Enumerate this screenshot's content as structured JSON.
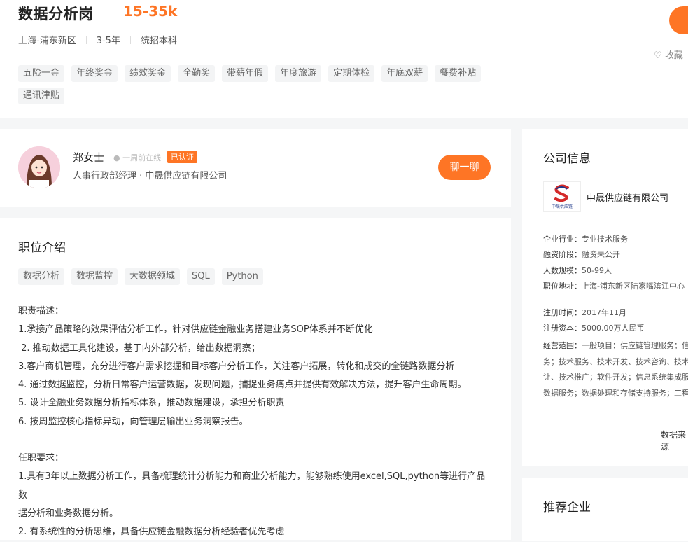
{
  "job": {
    "title": "数据分析岗",
    "salary": "15-35k",
    "location": "上海-浦东新区",
    "experience": "3-5年",
    "education": "统招本科",
    "collect_label": "收藏",
    "benefits": [
      "五险一金",
      "年终奖金",
      "绩效奖金",
      "全勤奖",
      "带薪年假",
      "年度旅游",
      "定期体检",
      "年底双薪",
      "餐费补贴",
      "通讯津贴"
    ]
  },
  "recruiter": {
    "name": "郑女士",
    "status": "一周前在线",
    "badge": "已认证",
    "title": "人事行政部经理 · 中晟供应链有限公司",
    "chat_label": "聊一聊"
  },
  "position": {
    "heading": "职位介绍",
    "skills": [
      "数据分析",
      "数据监控",
      "大数据领域",
      "SQL",
      "Python"
    ],
    "desc_lines": [
      "职责描述：",
      "1.承接产品策略的效果评估分析工作，针对供应链金融业务搭建业务SOP体系并不断优化",
      " 2. 推动数据工具化建设，基于内外部分析，给出数据洞察；",
      "3.客户商机管理，充分进行客户需求挖掘和目标客户分析工作，关注客户拓展，转化和成交的全链路数据分析",
      "4. 通过数据监控，分析日常客户运营数据，发现问题，捕捉业务痛点并提供有效解决方法，提升客户生命周期。",
      "5. 设计全融业务数据分析指标体系，推动数据建设，承担分析职责",
      "6. 按周监控核心指标异动，向管理层输出业务洞察报告。",
      "",
      "任职要求：",
      "1.具有3年以上数据分析工作，具备梳理统计分析能力和商业分析能力，能够熟练使用excel,SQL,python等进行产品数",
      "据分析和业务数据分析。",
      "2. 有系统性的分析思维，具备供应链金融数据分析经验者优先考虑"
    ]
  },
  "company": {
    "heading": "公司信息",
    "name": "中晟供应链有限公司",
    "logo_text": "中晟供应链",
    "industry_label": "企业行业：",
    "industry": "专业技术服务",
    "funding_label": "融资阶段：",
    "funding": "融资未公开",
    "size_label": "人数规模：",
    "size": "50-99人",
    "address_label": "职位地址：",
    "address": "上海-浦东新区陆家嘴滨江中心",
    "reg_date_label": "注册时间：",
    "reg_date": "2017年11月",
    "capital_label": "注册资本：",
    "capital": "5000.00万人民币",
    "scope_label": "经营范围：",
    "scope_lines": [
      "一般项目：供应链管理服务；信",
      "务；技术服务、技术开发、技术咨询、技术",
      "让、技术推广；软件开发；信息系统集成服",
      "数据服务；数据处理和存储支持服务；工程"
    ],
    "data_source": "数据来源"
  },
  "recommend": {
    "heading": "推荐企业"
  },
  "colors": {
    "accent": "#fe7525",
    "tag_bg": "#f3f4f5"
  }
}
